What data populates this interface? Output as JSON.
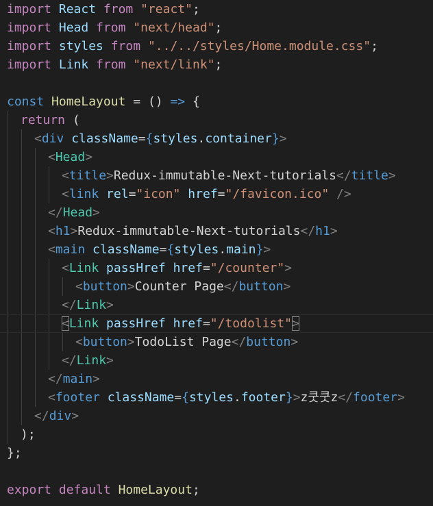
{
  "colors": {
    "background": "#1e1e1e",
    "keyword": "#c586c0",
    "declaration": "#569cd6",
    "variable": "#9cdcfe",
    "function": "#dcdcaa",
    "string": "#ce9178",
    "component_tag": "#4ec9b0",
    "html_tag": "#569cd6",
    "tag_bracket": "#808080",
    "text": "#d4d4d4"
  },
  "editor": {
    "cursor_line": 18,
    "lines": [
      {
        "indent": 0,
        "tokens": [
          [
            "kw",
            "import"
          ],
          [
            "txt",
            " "
          ],
          [
            "var",
            "React"
          ],
          [
            "txt",
            " "
          ],
          [
            "kw",
            "from"
          ],
          [
            "txt",
            " "
          ],
          [
            "str",
            "\"react\""
          ],
          [
            "punc",
            ";"
          ]
        ]
      },
      {
        "indent": 0,
        "tokens": [
          [
            "kw",
            "import"
          ],
          [
            "txt",
            " "
          ],
          [
            "var",
            "Head"
          ],
          [
            "txt",
            " "
          ],
          [
            "kw",
            "from"
          ],
          [
            "txt",
            " "
          ],
          [
            "str",
            "\"next/head\""
          ],
          [
            "punc",
            ";"
          ]
        ]
      },
      {
        "indent": 0,
        "tokens": [
          [
            "kw",
            "import"
          ],
          [
            "txt",
            " "
          ],
          [
            "var",
            "styles"
          ],
          [
            "txt",
            " "
          ],
          [
            "kw",
            "from"
          ],
          [
            "txt",
            " "
          ],
          [
            "str",
            "\"../../styles/Home.module.css\""
          ],
          [
            "punc",
            ";"
          ]
        ]
      },
      {
        "indent": 0,
        "tokens": [
          [
            "kw",
            "import"
          ],
          [
            "txt",
            " "
          ],
          [
            "var",
            "Link"
          ],
          [
            "txt",
            " "
          ],
          [
            "kw",
            "from"
          ],
          [
            "txt",
            " "
          ],
          [
            "str",
            "\"next/link\""
          ],
          [
            "punc",
            ";"
          ]
        ]
      },
      {
        "indent": 0,
        "tokens": []
      },
      {
        "indent": 0,
        "tokens": [
          [
            "dec",
            "const"
          ],
          [
            "txt",
            " "
          ],
          [
            "fn",
            "HomeLayout"
          ],
          [
            "txt",
            " "
          ],
          [
            "punc",
            "="
          ],
          [
            "txt",
            " "
          ],
          [
            "punc",
            "()"
          ],
          [
            "txt",
            " "
          ],
          [
            "dec",
            "=>"
          ],
          [
            "txt",
            " "
          ],
          [
            "punc",
            "{"
          ]
        ]
      },
      {
        "indent": 1,
        "tokens": [
          [
            "kw",
            "return"
          ],
          [
            "txt",
            " "
          ],
          [
            "punc",
            "("
          ]
        ]
      },
      {
        "indent": 2,
        "tokens": [
          [
            "tagb",
            "<"
          ],
          [
            "html",
            "div"
          ],
          [
            "txt",
            " "
          ],
          [
            "attr",
            "className"
          ],
          [
            "punc",
            "="
          ],
          [
            "brace",
            "{"
          ],
          [
            "var",
            "styles"
          ],
          [
            "punc",
            "."
          ],
          [
            "var",
            "container"
          ],
          [
            "brace",
            "}"
          ],
          [
            "tagb",
            ">"
          ]
        ]
      },
      {
        "indent": 3,
        "tokens": [
          [
            "tagb",
            "<"
          ],
          [
            "comp",
            "Head"
          ],
          [
            "tagb",
            ">"
          ]
        ]
      },
      {
        "indent": 4,
        "tokens": [
          [
            "tagb",
            "<"
          ],
          [
            "html",
            "title"
          ],
          [
            "tagb",
            ">"
          ],
          [
            "txt",
            "Redux-immutable-Next-tutorials"
          ],
          [
            "tagb",
            "</"
          ],
          [
            "html",
            "title"
          ],
          [
            "tagb",
            ">"
          ]
        ]
      },
      {
        "indent": 4,
        "tokens": [
          [
            "tagb",
            "<"
          ],
          [
            "html",
            "link"
          ],
          [
            "txt",
            " "
          ],
          [
            "attr",
            "rel"
          ],
          [
            "punc",
            "="
          ],
          [
            "str",
            "\"icon\""
          ],
          [
            "txt",
            " "
          ],
          [
            "attr",
            "href"
          ],
          [
            "punc",
            "="
          ],
          [
            "str",
            "\"/favicon.ico\""
          ],
          [
            "txt",
            " "
          ],
          [
            "tagb",
            "/>"
          ]
        ]
      },
      {
        "indent": 3,
        "tokens": [
          [
            "tagb",
            "</"
          ],
          [
            "comp",
            "Head"
          ],
          [
            "tagb",
            ">"
          ]
        ]
      },
      {
        "indent": 3,
        "tokens": [
          [
            "tagb",
            "<"
          ],
          [
            "html",
            "h1"
          ],
          [
            "tagb",
            ">"
          ],
          [
            "txt",
            "Redux-immutable-Next-tutorials"
          ],
          [
            "tagb",
            "</"
          ],
          [
            "html",
            "h1"
          ],
          [
            "tagb",
            ">"
          ]
        ]
      },
      {
        "indent": 3,
        "tokens": [
          [
            "tagb",
            "<"
          ],
          [
            "html",
            "main"
          ],
          [
            "txt",
            " "
          ],
          [
            "attr",
            "className"
          ],
          [
            "punc",
            "="
          ],
          [
            "brace",
            "{"
          ],
          [
            "var",
            "styles"
          ],
          [
            "punc",
            "."
          ],
          [
            "var",
            "main"
          ],
          [
            "brace",
            "}"
          ],
          [
            "tagb",
            ">"
          ]
        ]
      },
      {
        "indent": 4,
        "tokens": [
          [
            "tagb",
            "<"
          ],
          [
            "comp",
            "Link"
          ],
          [
            "txt",
            " "
          ],
          [
            "attr",
            "passHref"
          ],
          [
            "txt",
            " "
          ],
          [
            "attr",
            "href"
          ],
          [
            "punc",
            "="
          ],
          [
            "str",
            "\"/counter\""
          ],
          [
            "tagb",
            ">"
          ]
        ]
      },
      {
        "indent": 5,
        "tokens": [
          [
            "tagb",
            "<"
          ],
          [
            "html",
            "button"
          ],
          [
            "tagb",
            ">"
          ],
          [
            "txt",
            "Counter Page"
          ],
          [
            "tagb",
            "</"
          ],
          [
            "html",
            "button"
          ],
          [
            "tagb",
            ">"
          ]
        ]
      },
      {
        "indent": 4,
        "tokens": [
          [
            "tagb",
            "</"
          ],
          [
            "comp",
            "Link"
          ],
          [
            "tagb",
            ">"
          ]
        ]
      },
      {
        "indent": 4,
        "tokens": [
          [
            "tagbm",
            "<"
          ],
          [
            "comp",
            "Link"
          ],
          [
            "txt",
            " "
          ],
          [
            "attr",
            "passHref"
          ],
          [
            "txt",
            " "
          ],
          [
            "attr",
            "href"
          ],
          [
            "punc",
            "="
          ],
          [
            "str",
            "\"/todolist\""
          ],
          [
            "tagbm",
            ">"
          ]
        ]
      },
      {
        "indent": 5,
        "tokens": [
          [
            "tagb",
            "<"
          ],
          [
            "html",
            "button"
          ],
          [
            "tagb",
            ">"
          ],
          [
            "txt",
            "TodoList Page"
          ],
          [
            "tagb",
            "</"
          ],
          [
            "html",
            "button"
          ],
          [
            "tagb",
            ">"
          ]
        ]
      },
      {
        "indent": 4,
        "tokens": [
          [
            "tagb",
            "</"
          ],
          [
            "comp",
            "Link"
          ],
          [
            "tagb",
            ">"
          ]
        ]
      },
      {
        "indent": 3,
        "tokens": [
          [
            "tagb",
            "</"
          ],
          [
            "html",
            "main"
          ],
          [
            "tagb",
            ">"
          ]
        ]
      },
      {
        "indent": 3,
        "tokens": [
          [
            "tagb",
            "<"
          ],
          [
            "html",
            "footer"
          ],
          [
            "txt",
            " "
          ],
          [
            "attr",
            "className"
          ],
          [
            "punc",
            "="
          ],
          [
            "brace",
            "{"
          ],
          [
            "var",
            "styles"
          ],
          [
            "punc",
            "."
          ],
          [
            "var",
            "footer"
          ],
          [
            "brace",
            "}"
          ],
          [
            "tagb",
            ">"
          ],
          [
            "txt",
            "z쿳쿳z"
          ],
          [
            "tagb",
            "</"
          ],
          [
            "html",
            "footer"
          ],
          [
            "tagb",
            ">"
          ]
        ]
      },
      {
        "indent": 2,
        "tokens": [
          [
            "tagb",
            "</"
          ],
          [
            "html",
            "div"
          ],
          [
            "tagb",
            ">"
          ]
        ]
      },
      {
        "indent": 1,
        "tokens": [
          [
            "punc",
            ");"
          ]
        ]
      },
      {
        "indent": 0,
        "tokens": [
          [
            "punc",
            "};"
          ]
        ]
      },
      {
        "indent": 0,
        "tokens": []
      },
      {
        "indent": 0,
        "tokens": [
          [
            "kw",
            "export"
          ],
          [
            "txt",
            " "
          ],
          [
            "kw",
            "default"
          ],
          [
            "txt",
            " "
          ],
          [
            "fn",
            "HomeLayout"
          ],
          [
            "punc",
            ";"
          ]
        ]
      }
    ]
  }
}
